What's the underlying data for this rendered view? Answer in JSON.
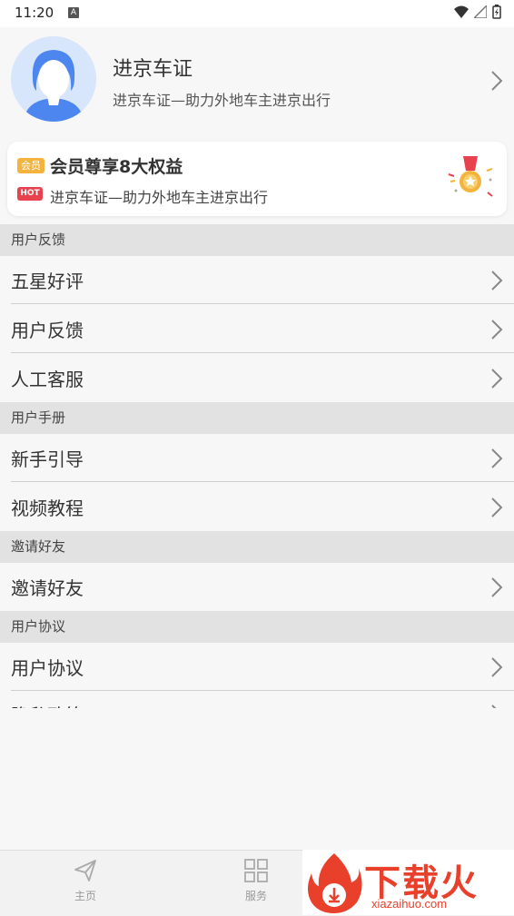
{
  "status_bar": {
    "time": "11:20",
    "notification_letter": "A"
  },
  "profile": {
    "title": "进京车证",
    "subtitle": "进京车证—助力外地车主进京出行"
  },
  "member_card": {
    "vip_badge": "会员",
    "title": "会员尊享8大权益",
    "hot_badge": "HOT",
    "subtitle": "进京车证—助力外地车主进京出行"
  },
  "sections": [
    {
      "header": "用户反馈",
      "items": [
        "五星好评",
        "用户反馈",
        "人工客服"
      ]
    },
    {
      "header": "用户手册",
      "items": [
        "新手引导",
        "视频教程"
      ]
    },
    {
      "header": "邀请好友",
      "items": [
        "邀请好友"
      ]
    },
    {
      "header": "用户协议",
      "items": [
        "用户协议"
      ]
    }
  ],
  "partial_item": "隐私政策",
  "bottom_nav": {
    "home_label": "主页",
    "service_label": "服务"
  },
  "watermark": {
    "text": "下载火",
    "sub": "xiazaihuo.com"
  },
  "colors": {
    "accent_red": "#e8424e",
    "vip_gold": "#f3b33d",
    "section_bg": "#e2e2e2"
  }
}
